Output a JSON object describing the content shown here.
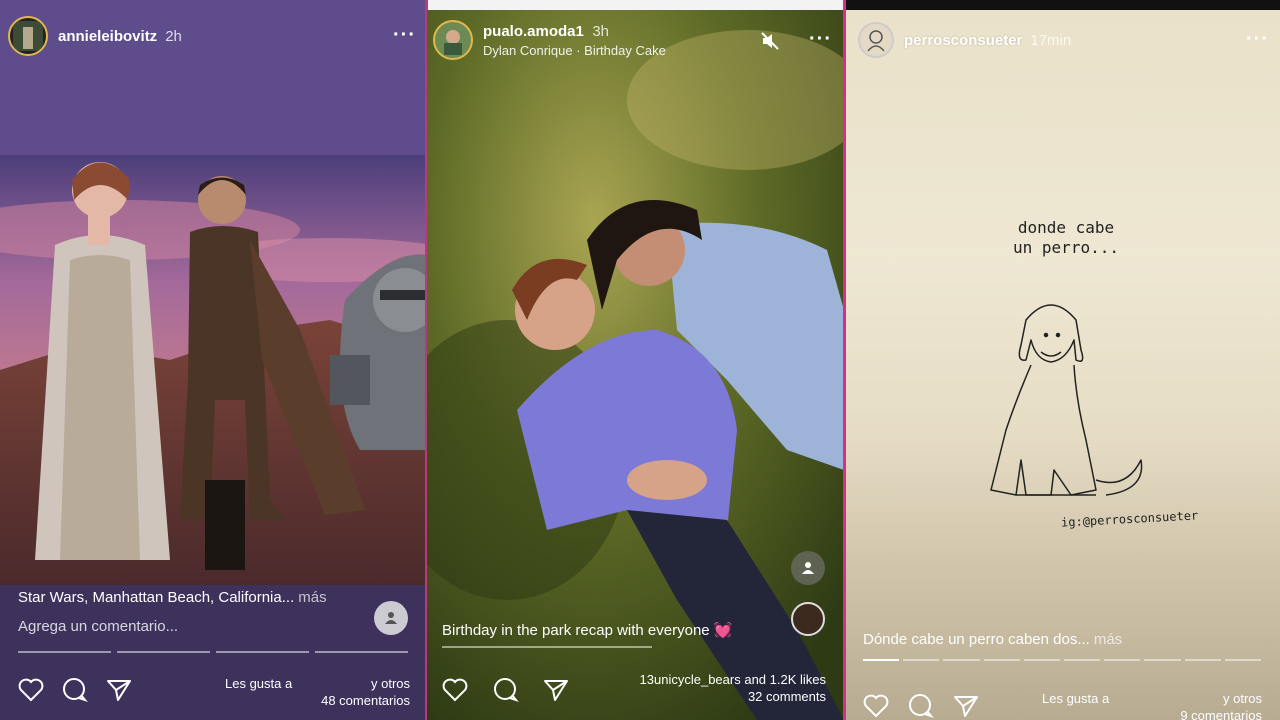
{
  "stories": [
    {
      "username": "annieleibovitz",
      "time_ago": "2h",
      "caption": "Star Wars, Manhattan Beach, California...",
      "more_label": "más",
      "comment_placeholder": "Agrega un comentario...",
      "likes_prefix": "Les gusta a",
      "likes_suffix": "y otros",
      "comments": "48 comentarios"
    },
    {
      "username": "pualo.amoda1",
      "time_ago": "3h",
      "music": "Dylan Conrique · Birthday Cake",
      "caption": "Birthday in the park recap with everyone",
      "caption_emoji": "💓",
      "likes": "13unicycle_bears and 1.2K likes",
      "comments": "32 comments"
    },
    {
      "username": "perrosconsueter",
      "time_ago": "17min",
      "drawing_text_line1": "donde cabe",
      "drawing_text_line2": "un perro...",
      "drawing_signature": "ig:@perrosconsueter",
      "caption": "Dónde cabe un perro caben dos...",
      "more_label": "más",
      "likes_prefix": "Les gusta a",
      "likes_suffix": "y otros",
      "comments": "9 comentarios"
    }
  ],
  "icons": {
    "more": "more-dots-icon",
    "like": "heart-icon",
    "comment": "comment-bubble-icon",
    "share": "send-icon",
    "tag": "person-tag-icon",
    "mute": "mute-icon"
  },
  "colors": {
    "panel1_bg": "#55437f",
    "panel2_bg": "#3e4a1e",
    "panel3_bg": "#e9e1c9",
    "divider_accent": "#d62f8a"
  }
}
